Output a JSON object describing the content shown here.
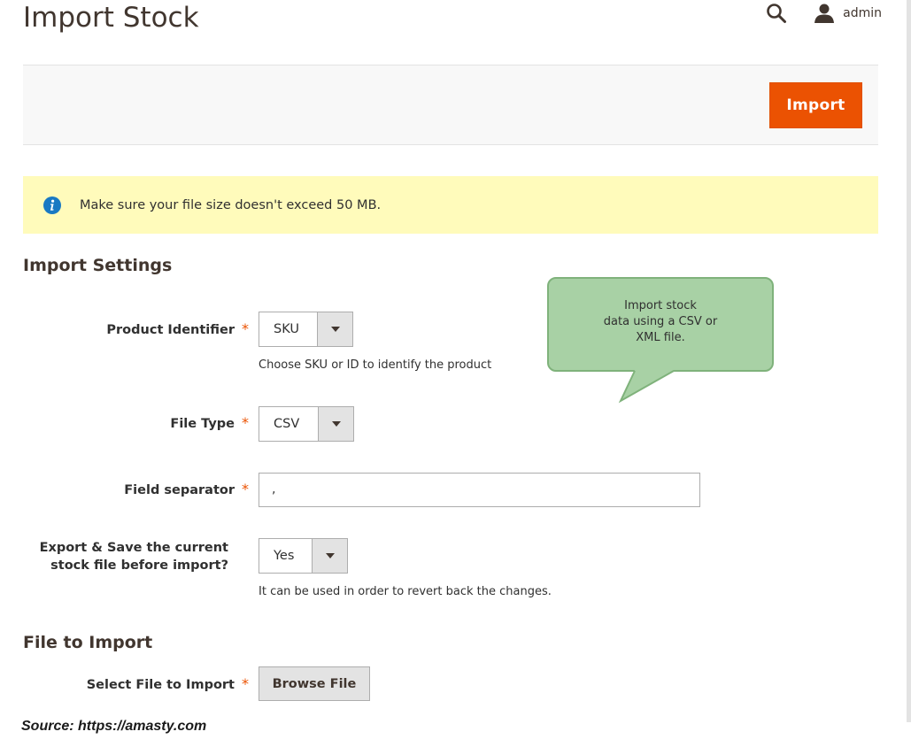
{
  "page": {
    "title": "Import Stock"
  },
  "header": {
    "user_name": "admin",
    "icons": [
      "search-icon",
      "user-icon"
    ]
  },
  "action_bar": {
    "import_label": "Import"
  },
  "notice": {
    "text": "Make sure your file size doesn't exceed 50 MB.",
    "icon": "info-icon"
  },
  "import_settings": {
    "title": "Import Settings",
    "product_identifier": {
      "label": "Product Identifier",
      "required": "*",
      "value": "SKU",
      "note": "Choose SKU or ID to identify the product"
    },
    "file_type": {
      "label": "File Type",
      "required": "*",
      "value": "CSV"
    },
    "field_separator": {
      "label": "Field separator",
      "required": "*",
      "value": ","
    },
    "export_save": {
      "label_line1": "Export & Save the current",
      "label_line2": "stock file before import?",
      "value": "Yes",
      "note": "It can be used in order to revert back the changes."
    }
  },
  "file_to_import": {
    "title": "File to Import",
    "select_file": {
      "label": "Select File to Import",
      "required": "*",
      "button_label": "Browse File"
    }
  },
  "tooltip": {
    "line1": "Import stock",
    "line2": "data using a CSV or",
    "line3": "XML file."
  },
  "footer": {
    "source": "Source: https://amasty.com"
  },
  "colors": {
    "accent": "#eb5202",
    "notice_bg": "#fffbbb",
    "info_icon": "#1979c3",
    "tooltip_bg": "#a8d1a5",
    "tooltip_border": "#7fb27b"
  }
}
